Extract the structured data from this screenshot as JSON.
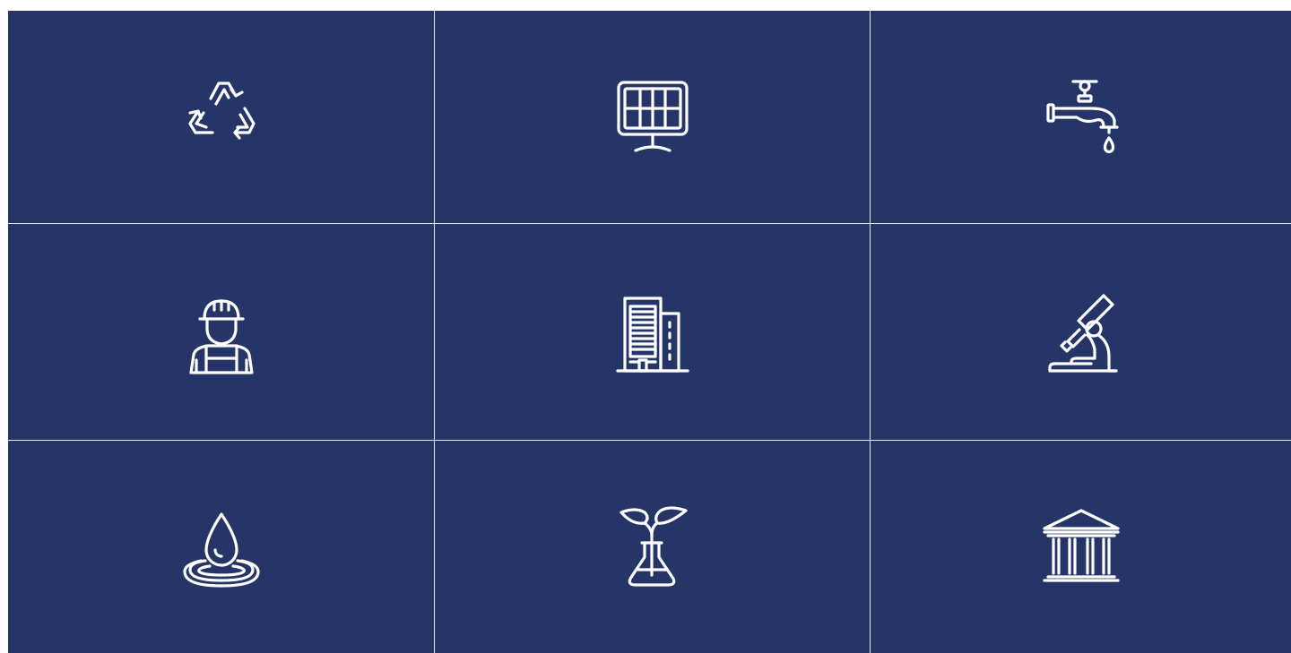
{
  "colors": {
    "tile_background": "#253567",
    "divider": "#e3e7f0",
    "icon_stroke": "#ffffff"
  },
  "tiles": [
    {
      "icon": "recycle-icon"
    },
    {
      "icon": "solar-panel-icon"
    },
    {
      "icon": "water-faucet-icon"
    },
    {
      "icon": "construction-worker-icon"
    },
    {
      "icon": "office-building-icon"
    },
    {
      "icon": "microscope-icon"
    },
    {
      "icon": "water-drop-ripple-icon"
    },
    {
      "icon": "plant-flask-icon"
    },
    {
      "icon": "government-building-icon"
    }
  ]
}
